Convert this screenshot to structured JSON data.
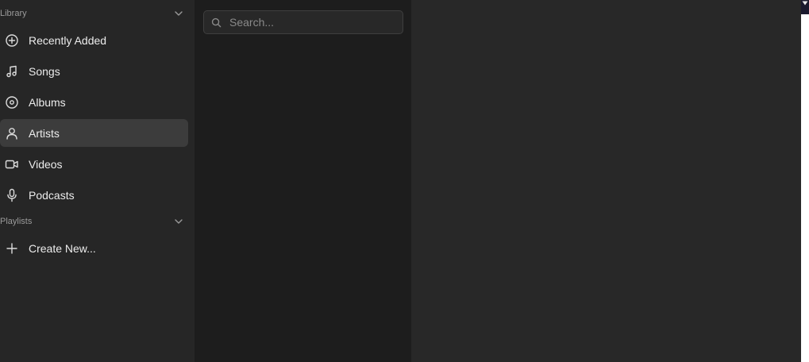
{
  "sidebar": {
    "library": {
      "title": "Library",
      "chevron_icon": "chevron-down-icon",
      "items": [
        {
          "label": "Recently Added",
          "icon": "plus-circle-icon",
          "active": false
        },
        {
          "label": "Songs",
          "icon": "music-note-icon",
          "active": false
        },
        {
          "label": "Albums",
          "icon": "disc-icon",
          "active": false
        },
        {
          "label": "Artists",
          "icon": "person-icon",
          "active": true
        },
        {
          "label": "Videos",
          "icon": "video-camera-icon",
          "active": false
        },
        {
          "label": "Podcasts",
          "icon": "microphone-icon",
          "active": false
        }
      ]
    },
    "playlists": {
      "title": "Playlists",
      "chevron_icon": "chevron-down-icon",
      "items": [
        {
          "label": "Create New...",
          "icon": "plus-icon"
        }
      ]
    }
  },
  "search": {
    "placeholder": "Search...",
    "value": "",
    "icon": "search-icon"
  },
  "edge": {
    "icon": "caret-down-icon"
  },
  "colors": {
    "sidebar_bg": "#262626",
    "list_bg": "#1d1d1d",
    "content_bg": "#282828",
    "active_item_bg": "#3c3c3c",
    "text": "#ececec",
    "muted_text": "#9a9a9a"
  }
}
